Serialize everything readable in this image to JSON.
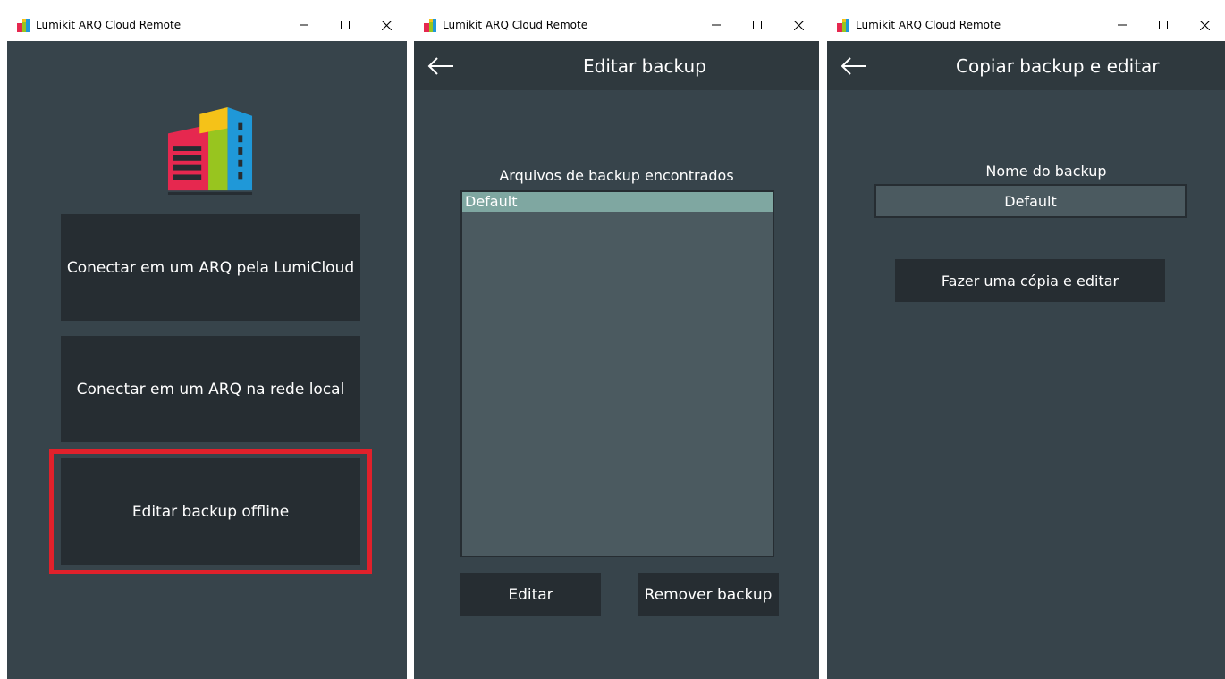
{
  "windows": [
    {
      "title": "Lumikit ARQ Cloud Remote",
      "buttons": {
        "cloud": "Conectar em um ARQ pela LumiCloud",
        "local": "Conectar em um ARQ na rede local",
        "offline": "Editar backup offline"
      },
      "highlight_color": "#e0212b"
    },
    {
      "title": "Lumikit ARQ Cloud Remote",
      "header": "Editar backup",
      "list_label": "Arquivos de backup encontrados",
      "files": [
        "Default"
      ],
      "selected_index": 0,
      "edit_button": "Editar",
      "remove_button": "Remover backup"
    },
    {
      "title": "Lumikit ARQ Cloud Remote",
      "header": "Copiar backup e editar",
      "name_label": "Nome do backup",
      "name_value": "Default",
      "copy_button": "Fazer uma cópia e editar"
    }
  ],
  "icons": {
    "minimize": "minimize-icon",
    "maximize": "maximize-icon",
    "close": "close-icon",
    "back": "back-arrow-icon",
    "app": "app-icon",
    "logo": "logo-icon"
  },
  "colors": {
    "background": "#37444b",
    "appbar": "#2f393e",
    "button": "#262d32",
    "list": "#4b5a60",
    "list_selected": "#7fa7a1"
  }
}
